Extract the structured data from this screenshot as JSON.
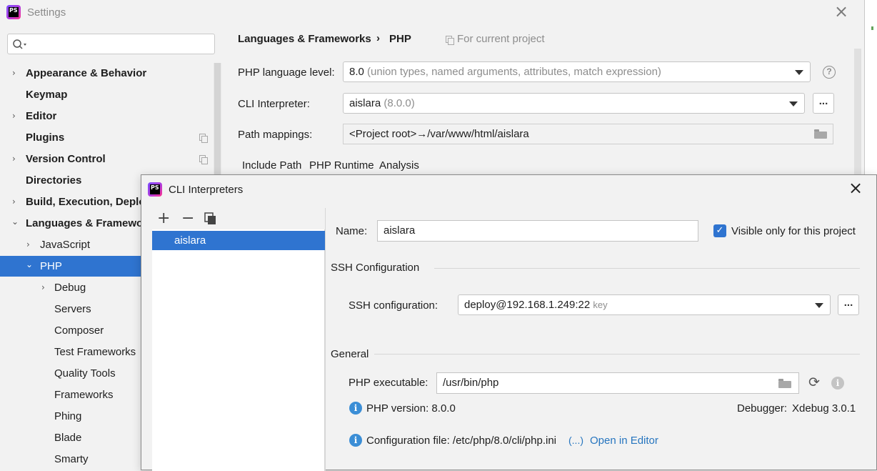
{
  "settings": {
    "title": "Settings",
    "breadcrumb": {
      "section": "Languages & Frameworks",
      "separator": "›",
      "page": "PHP"
    },
    "for_current_project": "For current project",
    "php_language_level": {
      "label": "PHP language level:",
      "value": "8.0",
      "detail": "(union types, named arguments, attributes, match expression)"
    },
    "cli_interpreter": {
      "label": "CLI Interpreter:",
      "value": "aislara",
      "detail": "(8.0.0)",
      "button": "..."
    },
    "path_mappings": {
      "label": "Path mappings:",
      "value": "<Project root>→/var/www/html/aislara"
    },
    "tabs": [
      "Include Path",
      "PHP Runtime",
      "Analysis"
    ],
    "help": "?"
  },
  "sidebar": {
    "search_placeholder": "",
    "items": [
      {
        "label": "Appearance & Behavior",
        "bold": true,
        "chevron": "›"
      },
      {
        "label": "Keymap",
        "bold": true
      },
      {
        "label": "Editor",
        "bold": true,
        "chevron": "›"
      },
      {
        "label": "Plugins",
        "bold": true
      },
      {
        "label": "Version Control",
        "bold": true,
        "chevron": "›"
      },
      {
        "label": "Directories",
        "bold": true
      },
      {
        "label": "Build, Execution, Deployment",
        "bold": true,
        "chevron": "›"
      },
      {
        "label": "Languages & Frameworks",
        "bold": true,
        "chevron": "⌄"
      },
      {
        "label": "JavaScript",
        "chevron": "›"
      },
      {
        "label": "PHP",
        "chevron": "⌄",
        "selected": true
      },
      {
        "label": "Debug",
        "chevron": "›"
      },
      {
        "label": "Servers"
      },
      {
        "label": "Composer"
      },
      {
        "label": "Test Frameworks"
      },
      {
        "label": "Quality Tools"
      },
      {
        "label": "Frameworks"
      },
      {
        "label": "Phing"
      },
      {
        "label": "Blade"
      },
      {
        "label": "Smarty"
      }
    ]
  },
  "dialog": {
    "title": "CLI Interpreters",
    "toolbar": {
      "add": "+",
      "remove": "−"
    },
    "interpreters": [
      "aislara"
    ],
    "name": {
      "label": "Name:",
      "value": "aislara"
    },
    "visible_only": {
      "label": "Visible only for this project",
      "checked": true,
      "mark": "✓"
    },
    "ssh_section": "SSH Configuration",
    "ssh_config": {
      "label": "SSH configuration:",
      "value": "deploy@192.168.1.249:22",
      "detail": "key",
      "button": "..."
    },
    "general_section": "General",
    "php_executable": {
      "label": "PHP executable:",
      "value": "/usr/bin/php"
    },
    "php_version": "PHP version: 8.0.0",
    "debugger": {
      "label": "Debugger:",
      "value": "Xdebug 3.0.1"
    },
    "config_file": {
      "label": "Configuration file: /etc/php/8.0/cli/php.ini",
      "more": "(...)",
      "open_link": "Open in Editor"
    },
    "info_mark": "i"
  },
  "colors": {
    "selection": "#2f74d0",
    "link": "#2675bf",
    "info": "#3b8ed6"
  }
}
